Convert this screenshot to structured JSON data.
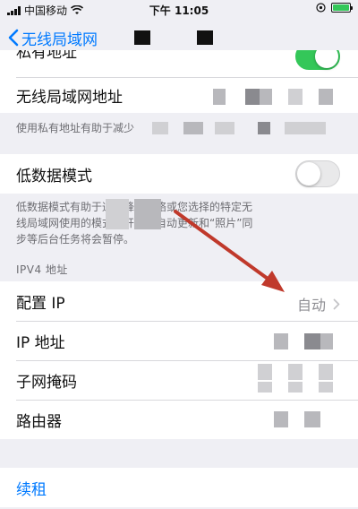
{
  "status_bar": {
    "carrier": "中国移动",
    "time": "下午 11:05"
  },
  "nav": {
    "back_label": "无线局域网"
  },
  "private_address": {
    "label": "私有地址",
    "toggle_on": true
  },
  "wlan_address": {
    "label": "无线局域网地址"
  },
  "private_footnote": "使用私有地址有助于减少",
  "low_data": {
    "label": "低数据模式",
    "toggle_on": false,
    "footnote_line1": "低数据模式有助于通过蜂窝网络或您选择的特定无",
    "footnote_line2": "线局域网使用的模式打开时，自动更新和“照片”同",
    "footnote_line3": "步等后台任务将会暂停。"
  },
  "ipv4": {
    "header": "IPV4 地址",
    "rows": [
      {
        "label": "配置 IP",
        "value": "自动"
      },
      {
        "label": "IP 地址"
      },
      {
        "label": "子网掩码"
      },
      {
        "label": "路由器"
      }
    ]
  },
  "renew": {
    "label": "续租"
  },
  "colors": {
    "accent": "#007aff",
    "toggle_on": "#34c759",
    "annotation_arrow": "#c0392b"
  },
  "icons": [
    "wifi-icon",
    "location-icon",
    "battery-icon",
    "chevron-left-icon",
    "chevron-right-icon"
  ]
}
